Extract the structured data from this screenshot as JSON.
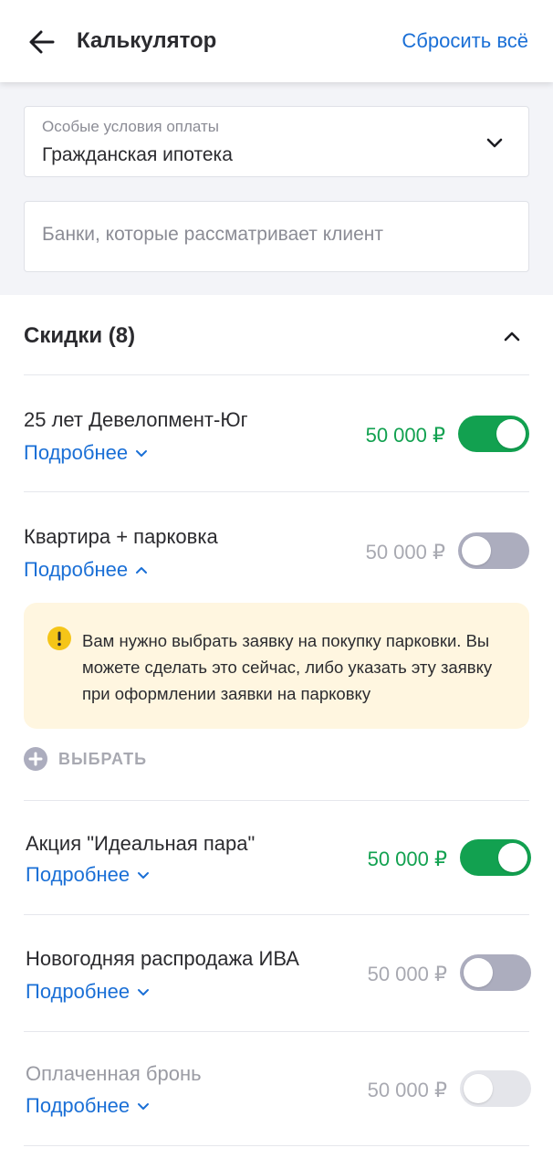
{
  "header": {
    "title": "Калькулятор",
    "reset_label": "Сбросить всё",
    "back_icon": "arrow-left-icon"
  },
  "filters": {
    "payment": {
      "label": "Особые условия оплаты",
      "value": "Гражданская ипотека"
    },
    "banks": {
      "placeholder": "Банки, которые рассматривает клиент",
      "value": ""
    }
  },
  "discounts": {
    "title": "Скидки (8)",
    "expanded": true,
    "more_label": "Подробнее",
    "items": [
      {
        "title": "25 лет Девелопмент-Юг",
        "amount": "50 000 ₽",
        "state": "on"
      },
      {
        "title": "Квартира + парковка",
        "amount": "50 000 ₽",
        "state": "off",
        "details_open": true
      },
      {
        "title": "Акция \"Идеальная пара\"",
        "amount": "50 000 ₽",
        "state": "on"
      },
      {
        "title": "Новогодняя распродажа ИВА",
        "amount": "50 000 ₽",
        "state": "off"
      },
      {
        "title": "Оплаченная бронь",
        "amount": "50 000 ₽",
        "state": "disabled"
      }
    ]
  },
  "parking_warning": {
    "text": "Вам нужно выбрать заявку на покупку парковки. Вы можете сделать это сейчас, либо указать эту заявку при оформлении заявки на парковку",
    "choose_label": "ВЫБРАТЬ"
  },
  "colors": {
    "accent": "#1a6fd6",
    "success": "#12a150",
    "toggle_off": "#acadbe",
    "warning_bg": "#fff6e0",
    "warning_icon": "#f5c518"
  }
}
